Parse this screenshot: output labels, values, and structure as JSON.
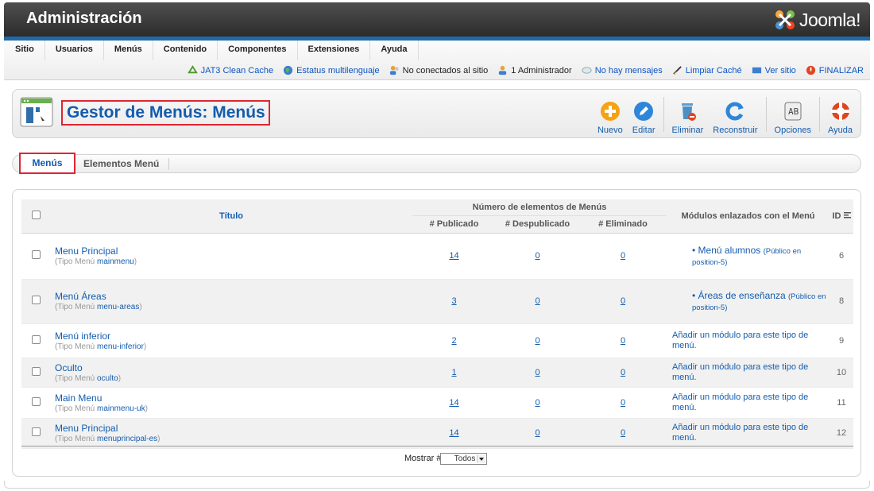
{
  "header": {
    "title": "Administración",
    "brand": "Joomla!"
  },
  "mainmenu": [
    "Sitio",
    "Usuarios",
    "Menús",
    "Contenido",
    "Componentes",
    "Extensiones",
    "Ayuda"
  ],
  "status": {
    "cache": "JAT3 Clean Cache",
    "multilang": "Estatus multilenguaje",
    "not_connected": "No conectados al sitio",
    "admins": "1 Administrador",
    "messages": "No hay mensajes",
    "clear_cache": "Limpiar Caché",
    "view_site": "Ver sitio",
    "logout": "FINALIZAR"
  },
  "page": {
    "title": "Gestor de Menús: Menús"
  },
  "toolbar": {
    "nuevo": "Nuevo",
    "editar": "Editar",
    "eliminar": "Eliminar",
    "reconstruir": "Reconstruir",
    "opciones": "Opciones",
    "ayuda": "Ayuda"
  },
  "tabs": {
    "menus": "Menús",
    "elementos": "Elementos Menú"
  },
  "table": {
    "col_title": "Título",
    "col_group": "Número de elementos de Menús",
    "col_published": "# Publicado",
    "col_unpublished": "# Despublicado",
    "col_trashed": "# Eliminado",
    "col_modules": "Módulos enlazados con el Menú",
    "col_id": "ID",
    "menu_type_prefix": "(Tipo Menú",
    "rows": [
      {
        "title": "Menu Principal",
        "type": "mainmenu",
        "published": "14",
        "unpublished": "0",
        "trashed": "0",
        "module": "Menú alumnos",
        "module_info": "(Público en position-5)",
        "add": "",
        "id": "6"
      },
      {
        "title": "Menú Áreas",
        "type": "menu-areas",
        "published": "3",
        "unpublished": "0",
        "trashed": "0",
        "module": "Áreas de enseñanza",
        "module_info": "(Público en position-5)",
        "add": "",
        "id": "8"
      },
      {
        "title": "Menú inferior",
        "type": "menu-inferior",
        "published": "2",
        "unpublished": "0",
        "trashed": "0",
        "module": "",
        "module_info": "",
        "add": "Añadir un módulo para este tipo de menú.",
        "id": "9"
      },
      {
        "title": "Oculto",
        "type": "oculto",
        "published": "1",
        "unpublished": "0",
        "trashed": "0",
        "module": "",
        "module_info": "",
        "add": "Añadir un módulo para este tipo de menú.",
        "id": "10"
      },
      {
        "title": "Main Menu",
        "type": "mainmenu-uk",
        "published": "14",
        "unpublished": "0",
        "trashed": "0",
        "module": "",
        "module_info": "",
        "add": "Añadir un módulo para este tipo de menú.",
        "id": "11"
      },
      {
        "title": "Menu Principal",
        "type": "menuprincipal-es",
        "published": "14",
        "unpublished": "0",
        "trashed": "0",
        "module": "",
        "module_info": "",
        "add": "Añadir un módulo para este tipo de menú.",
        "id": "12"
      }
    ]
  },
  "footer": {
    "show_label": "Mostrar #",
    "show_value": "Todos"
  },
  "colors": {
    "accent": "#135cae",
    "highlight": "#e02432",
    "header": "#2a2a2a"
  }
}
